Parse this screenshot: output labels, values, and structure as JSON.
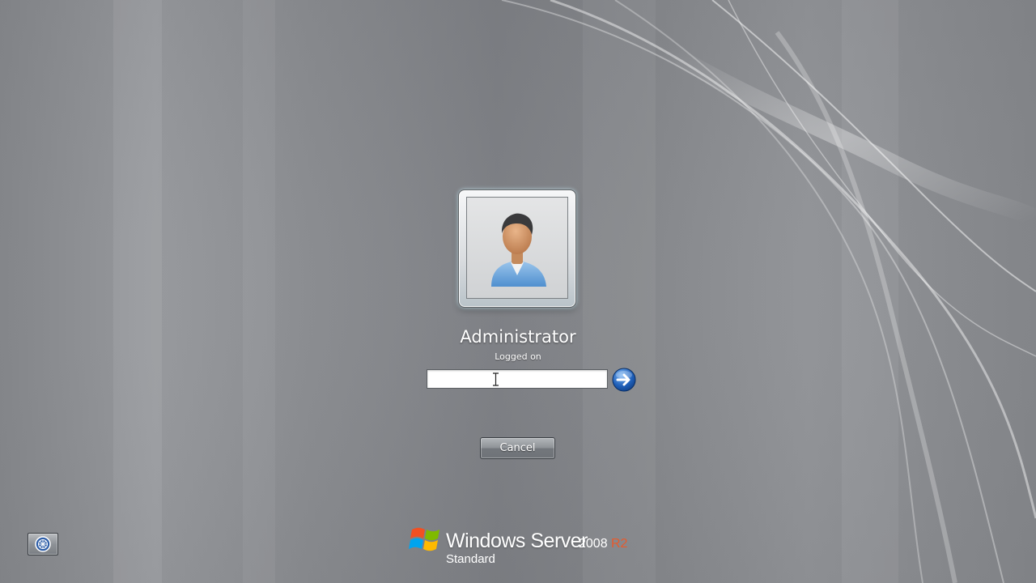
{
  "user": {
    "name": "Administrator",
    "status": "Logged on"
  },
  "password": {
    "value": "",
    "placeholder": ""
  },
  "buttons": {
    "cancel_label": "Cancel",
    "submit_icon": "arrow-right-icon",
    "ease_of_access_icon": "ease-of-access-icon"
  },
  "branding": {
    "product": "Windows Server",
    "version": "2008",
    "release": "R2",
    "edition": "Standard"
  },
  "colors": {
    "background": "#8f9195",
    "release_accent": "#e85a2b",
    "submit_button": "#1f5fb8"
  }
}
